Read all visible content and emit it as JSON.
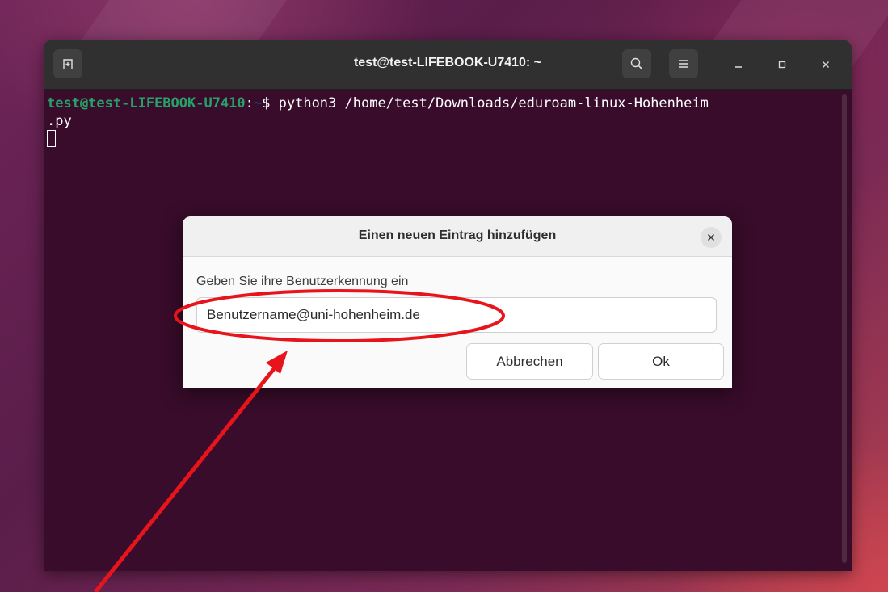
{
  "terminal": {
    "title": "test@test-LIFEBOOK-U7410: ~",
    "prompt_user": "test@test-LIFEBOOK-U7410",
    "prompt_sep": ":",
    "prompt_path": "~",
    "prompt_symbol": "$ ",
    "command_line1": "python3 /home/test/Downloads/eduroam-linux-Hohenheim",
    "command_line2": ".py"
  },
  "dialog": {
    "title": "Einen neuen Eintrag hinzufügen",
    "label": "Geben Sie ihre Benutzerkennung ein",
    "input_value": "Benutzername@uni-hohenheim.de",
    "cancel_label": "Abbrechen",
    "ok_label": "Ok"
  },
  "icons": {
    "new_tab": "new-tab-icon",
    "search": "search-icon",
    "menu": "hamburger-menu-icon",
    "minimize": "minimize-icon",
    "maximize": "maximize-icon",
    "close": "close-icon",
    "dialog_close": "close-icon"
  },
  "colors": {
    "terminal_bg": "#380c2a",
    "prompt_user": "#26a269",
    "prompt_path": "#12488b",
    "annotation": "#e8141c"
  }
}
